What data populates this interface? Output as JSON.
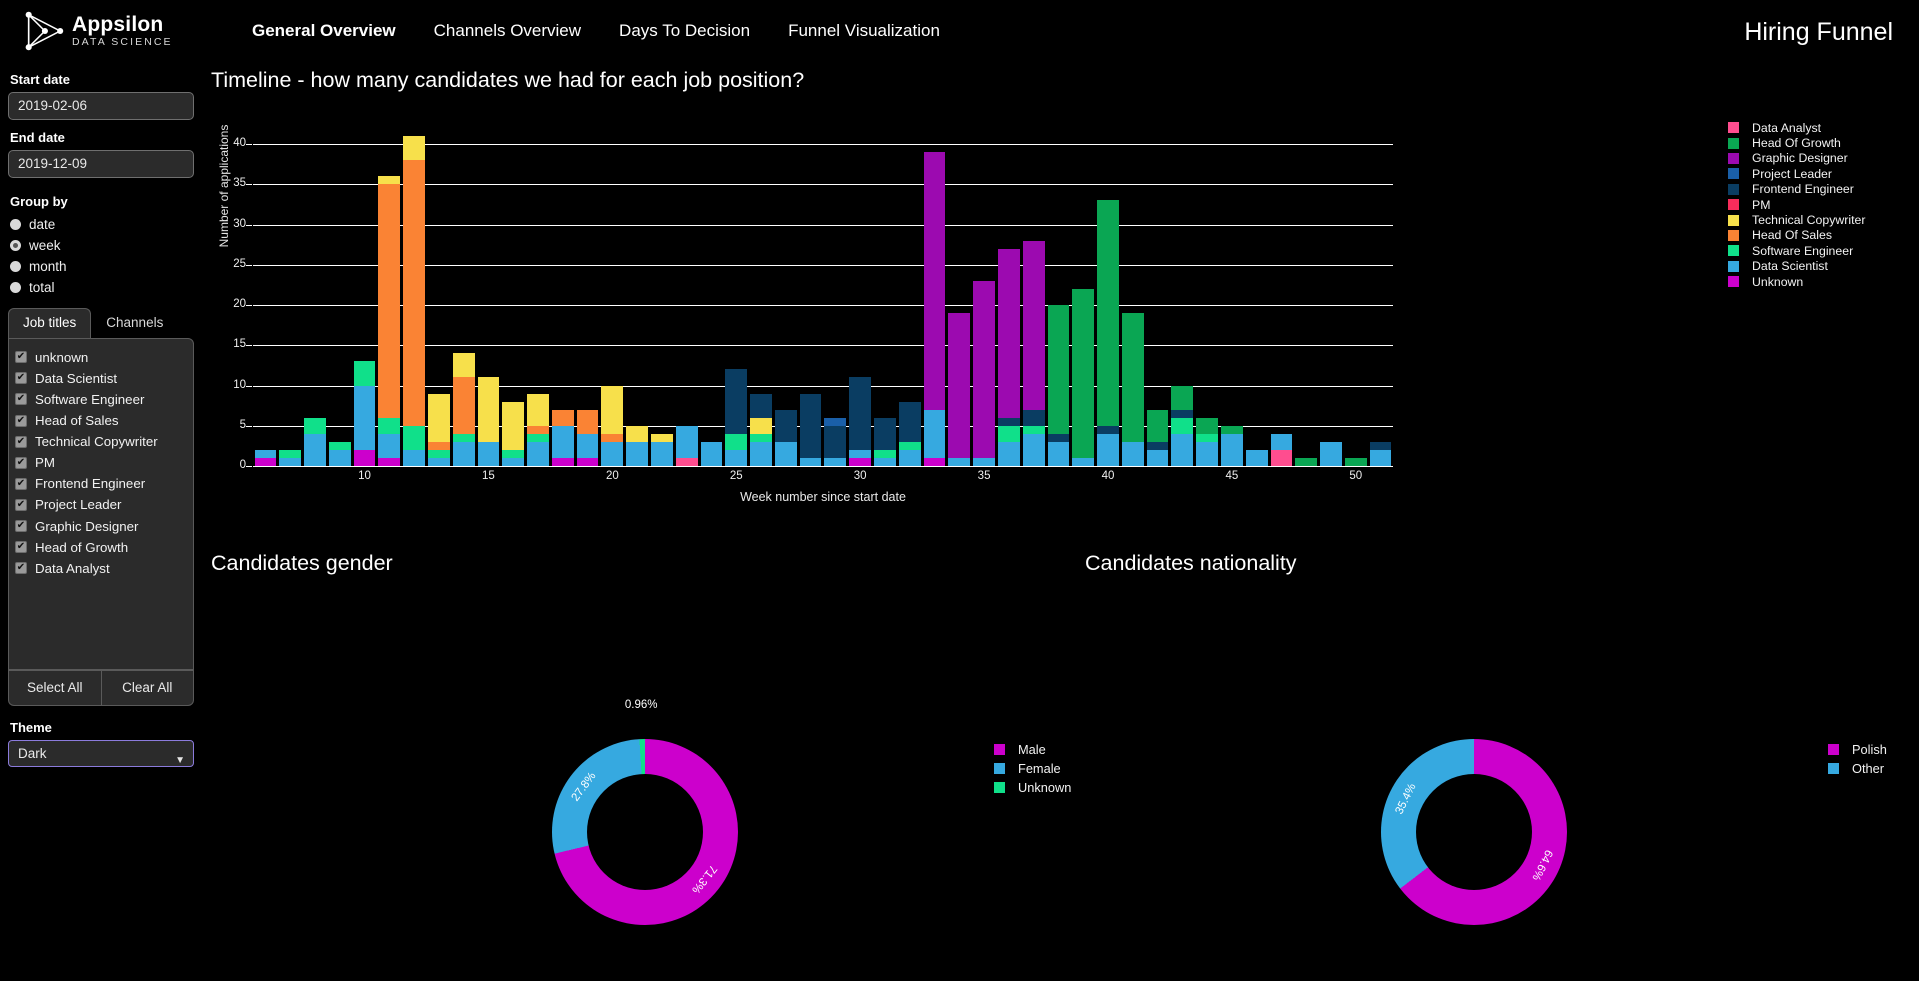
{
  "brand": {
    "name": "Appsilon",
    "tagline": "DATA SCIENCE",
    "logo_icon": "triangle-arrow-logo"
  },
  "nav": {
    "items": [
      {
        "label": "General Overview",
        "active": true
      },
      {
        "label": "Channels Overview",
        "active": false
      },
      {
        "label": "Days To Decision",
        "active": false
      },
      {
        "label": "Funnel Visualization",
        "active": false
      }
    ]
  },
  "app_title": "Hiring Funnel",
  "sidebar": {
    "start_date": {
      "label": "Start date",
      "value": "2019-02-06"
    },
    "end_date": {
      "label": "End date",
      "value": "2019-12-09"
    },
    "group_by": {
      "label": "Group by",
      "options": [
        "date",
        "week",
        "month",
        "total"
      ],
      "selected": "week"
    },
    "tabs": [
      {
        "label": "Job titles",
        "active": true
      },
      {
        "label": "Channels",
        "active": false
      }
    ],
    "job_titles": [
      {
        "label": "unknown",
        "checked": true
      },
      {
        "label": "Data Scientist",
        "checked": true
      },
      {
        "label": "Software Engineer",
        "checked": true
      },
      {
        "label": "Head of Sales",
        "checked": true
      },
      {
        "label": "Technical Copywriter",
        "checked": true
      },
      {
        "label": "PM",
        "checked": true
      },
      {
        "label": "Frontend Engineer",
        "checked": true
      },
      {
        "label": "Project Leader",
        "checked": true
      },
      {
        "label": "Graphic Designer",
        "checked": true
      },
      {
        "label": "Head of Growth",
        "checked": true
      },
      {
        "label": "Data Analyst",
        "checked": true
      }
    ],
    "select_all_label": "Select All",
    "clear_all_label": "Clear All",
    "theme": {
      "label": "Theme",
      "value": "Dark",
      "caret_icon": "chevron-down-icon"
    }
  },
  "chart_data": [
    {
      "id": "timeline",
      "type": "bar",
      "stacked": true,
      "title": "Timeline - how many candidates we had for each job position?",
      "xlabel": "Week number since start date",
      "ylabel": "Number of applications",
      "ylim": [
        0,
        41
      ],
      "yticks": [
        0,
        5,
        10,
        15,
        20,
        25,
        30,
        35,
        40
      ],
      "xticks": [
        10,
        15,
        20,
        25,
        30,
        35,
        40,
        45,
        50
      ],
      "grid": true,
      "legend_position": "right",
      "series": [
        {
          "name": "Data Analyst",
          "color": "#ff4d8f"
        },
        {
          "name": "Head Of Growth",
          "color": "#0aa653"
        },
        {
          "name": "Graphic Designer",
          "color": "#9c0ab0"
        },
        {
          "name": "Project Leader",
          "color": "#1a5fa8"
        },
        {
          "name": "Frontend Engineer",
          "color": "#0a3d62"
        },
        {
          "name": "PM",
          "color": "#f72c5b"
        },
        {
          "name": "Technical Copywriter",
          "color": "#f7e04b"
        },
        {
          "name": "Head Of Sales",
          "color": "#fa8334"
        },
        {
          "name": "Software Engineer",
          "color": "#10e08a"
        },
        {
          "name": "Data Scientist",
          "color": "#36a9e0"
        },
        {
          "name": "Unknown",
          "color": "#cc00cc"
        }
      ],
      "categories": [
        6,
        7,
        8,
        9,
        10,
        11,
        12,
        13,
        14,
        15,
        16,
        17,
        18,
        19,
        20,
        21,
        22,
        23,
        24,
        25,
        26,
        27,
        28,
        29,
        30,
        31,
        32,
        33,
        34,
        35,
        36,
        37,
        38,
        39,
        40,
        41,
        42,
        43,
        44,
        45,
        46,
        47,
        48,
        49,
        50
      ],
      "bars": [
        {
          "week": 6,
          "total": 2,
          "stack": [
            [
              "Unknown",
              1
            ],
            [
              "Data Scientist",
              1
            ]
          ]
        },
        {
          "week": 7,
          "total": 2,
          "stack": [
            [
              "Data Scientist",
              1
            ],
            [
              "Software Engineer",
              1
            ]
          ]
        },
        {
          "week": 8,
          "total": 6,
          "stack": [
            [
              "Data Scientist",
              4
            ],
            [
              "Software Engineer",
              2
            ]
          ]
        },
        {
          "week": 9,
          "total": 3,
          "stack": [
            [
              "Data Scientist",
              2
            ],
            [
              "Software Engineer",
              1
            ]
          ]
        },
        {
          "week": 10,
          "total": 13,
          "stack": [
            [
              "Unknown",
              2
            ],
            [
              "Data Scientist",
              8
            ],
            [
              "Software Engineer",
              3
            ]
          ]
        },
        {
          "week": 11,
          "total": 36,
          "stack": [
            [
              "Unknown",
              1
            ],
            [
              "Data Scientist",
              3
            ],
            [
              "Software Engineer",
              2
            ],
            [
              "Head Of Sales",
              29
            ],
            [
              "Technical Copywriter",
              1
            ]
          ]
        },
        {
          "week": 12,
          "total": 41,
          "stack": [
            [
              "Data Scientist",
              2
            ],
            [
              "Software Engineer",
              3
            ],
            [
              "Head Of Sales",
              33
            ],
            [
              "Technical Copywriter",
              3
            ]
          ]
        },
        {
          "week": 13,
          "total": 9,
          "stack": [
            [
              "Data Scientist",
              1
            ],
            [
              "Software Engineer",
              1
            ],
            [
              "Head Of Sales",
              1
            ],
            [
              "Technical Copywriter",
              6
            ]
          ]
        },
        {
          "week": 14,
          "total": 14,
          "stack": [
            [
              "Data Scientist",
              3
            ],
            [
              "Software Engineer",
              1
            ],
            [
              "Head Of Sales",
              7
            ],
            [
              "Technical Copywriter",
              3
            ]
          ]
        },
        {
          "week": 15,
          "total": 11,
          "stack": [
            [
              "Data Scientist",
              3
            ],
            [
              "Technical Copywriter",
              8
            ]
          ]
        },
        {
          "week": 16,
          "total": 8,
          "stack": [
            [
              "Data Scientist",
              1
            ],
            [
              "Software Engineer",
              1
            ],
            [
              "Technical Copywriter",
              6
            ]
          ]
        },
        {
          "week": 17,
          "total": 9,
          "stack": [
            [
              "Data Scientist",
              3
            ],
            [
              "Software Engineer",
              1
            ],
            [
              "Head Of Sales",
              1
            ],
            [
              "Technical Copywriter",
              4
            ]
          ]
        },
        {
          "week": 18,
          "total": 7,
          "stack": [
            [
              "Unknown",
              1
            ],
            [
              "Data Scientist",
              4
            ],
            [
              "Head Of Sales",
              2
            ]
          ]
        },
        {
          "week": 19,
          "total": 7,
          "stack": [
            [
              "Unknown",
              1
            ],
            [
              "Data Scientist",
              3
            ],
            [
              "Head Of Sales",
              3
            ]
          ]
        },
        {
          "week": 20,
          "total": 10,
          "stack": [
            [
              "Data Scientist",
              3
            ],
            [
              "Head Of Sales",
              1
            ],
            [
              "Technical Copywriter",
              6
            ]
          ]
        },
        {
          "week": 21,
          "total": 5,
          "stack": [
            [
              "Data Scientist",
              3
            ],
            [
              "Technical Copywriter",
              2
            ]
          ]
        },
        {
          "week": 22,
          "total": 4,
          "stack": [
            [
              "Data Scientist",
              3
            ],
            [
              "Technical Copywriter",
              1
            ]
          ]
        },
        {
          "week": 23,
          "total": 5,
          "stack": [
            [
              "Data Analyst",
              1
            ],
            [
              "Data Scientist",
              4
            ]
          ]
        },
        {
          "week": 24,
          "total": 3,
          "stack": [
            [
              "Data Scientist",
              3
            ]
          ]
        },
        {
          "week": 25,
          "total": 12,
          "stack": [
            [
              "Data Scientist",
              2
            ],
            [
              "Software Engineer",
              2
            ],
            [
              "Frontend Engineer",
              8
            ]
          ]
        },
        {
          "week": 26,
          "total": 9,
          "stack": [
            [
              "Data Scientist",
              3
            ],
            [
              "Software Engineer",
              1
            ],
            [
              "Technical Copywriter",
              2
            ],
            [
              "Frontend Engineer",
              3
            ]
          ]
        },
        {
          "week": 27,
          "total": 7,
          "stack": [
            [
              "Data Scientist",
              3
            ],
            [
              "Frontend Engineer",
              4
            ]
          ]
        },
        {
          "week": 28,
          "total": 9,
          "stack": [
            [
              "Data Scientist",
              1
            ],
            [
              "Frontend Engineer",
              8
            ]
          ]
        },
        {
          "week": 29,
          "total": 6,
          "stack": [
            [
              "Data Scientist",
              1
            ],
            [
              "Frontend Engineer",
              4
            ],
            [
              "Project Leader",
              1
            ]
          ]
        },
        {
          "week": 30,
          "total": 11,
          "stack": [
            [
              "Unknown",
              1
            ],
            [
              "Data Scientist",
              1
            ],
            [
              "Frontend Engineer",
              9
            ]
          ]
        },
        {
          "week": 31,
          "total": 6,
          "stack": [
            [
              "Data Scientist",
              1
            ],
            [
              "Software Engineer",
              1
            ],
            [
              "Frontend Engineer",
              4
            ]
          ]
        },
        {
          "week": 32,
          "total": 8,
          "stack": [
            [
              "Data Scientist",
              2
            ],
            [
              "Software Engineer",
              1
            ],
            [
              "Frontend Engineer",
              5
            ]
          ]
        },
        {
          "week": 33,
          "total": 39,
          "stack": [
            [
              "Unknown",
              1
            ],
            [
              "Data Scientist",
              6
            ],
            [
              "Graphic Designer",
              32
            ]
          ]
        },
        {
          "week": 34,
          "total": 19,
          "stack": [
            [
              "Data Scientist",
              1
            ],
            [
              "Graphic Designer",
              18
            ]
          ]
        },
        {
          "week": 35,
          "total": 23,
          "stack": [
            [
              "Data Scientist",
              1
            ],
            [
              "Graphic Designer",
              22
            ]
          ]
        },
        {
          "week": 36,
          "total": 27,
          "stack": [
            [
              "Data Scientist",
              3
            ],
            [
              "Software Engineer",
              2
            ],
            [
              "Frontend Engineer",
              1
            ],
            [
              "Graphic Designer",
              21
            ]
          ]
        },
        {
          "week": 37,
          "total": 28,
          "stack": [
            [
              "Data Scientist",
              4
            ],
            [
              "Software Engineer",
              1
            ],
            [
              "Frontend Engineer",
              2
            ],
            [
              "Graphic Designer",
              21
            ]
          ]
        },
        {
          "week": 38,
          "total": 20,
          "stack": [
            [
              "Data Scientist",
              3
            ],
            [
              "Frontend Engineer",
              1
            ],
            [
              "Head Of Growth",
              16
            ]
          ]
        },
        {
          "week": 39,
          "total": 22,
          "stack": [
            [
              "Data Scientist",
              1
            ],
            [
              "Head Of Growth",
              21
            ]
          ]
        },
        {
          "week": 40,
          "total": 33,
          "stack": [
            [
              "Data Scientist",
              4
            ],
            [
              "Frontend Engineer",
              1
            ],
            [
              "Head Of Growth",
              28
            ]
          ]
        },
        {
          "week": 41,
          "total": 19,
          "stack": [
            [
              "Data Scientist",
              3
            ],
            [
              "Head Of Growth",
              16
            ]
          ]
        },
        {
          "week": 42,
          "total": 7,
          "stack": [
            [
              "Data Scientist",
              2
            ],
            [
              "Frontend Engineer",
              1
            ],
            [
              "Head Of Growth",
              4
            ]
          ]
        },
        {
          "week": 43,
          "total": 10,
          "stack": [
            [
              "Data Scientist",
              4
            ],
            [
              "Software Engineer",
              2
            ],
            [
              "Frontend Engineer",
              1
            ],
            [
              "Head Of Growth",
              3
            ]
          ]
        },
        {
          "week": 44,
          "total": 6,
          "stack": [
            [
              "Data Scientist",
              3
            ],
            [
              "Software Engineer",
              1
            ],
            [
              "Head Of Growth",
              2
            ]
          ]
        },
        {
          "week": 45,
          "total": 5,
          "stack": [
            [
              "Data Scientist",
              4
            ],
            [
              "Head Of Growth",
              1
            ]
          ]
        },
        {
          "week": 46,
          "total": 2,
          "stack": [
            [
              "Data Scientist",
              2
            ]
          ]
        },
        {
          "week": 47,
          "total": 4,
          "stack": [
            [
              "Data Analyst",
              2
            ],
            [
              "Data Scientist",
              2
            ]
          ]
        },
        {
          "week": 48,
          "total": 1,
          "stack": [
            [
              "Head Of Growth",
              1
            ]
          ]
        },
        {
          "week": 49,
          "total": 3,
          "stack": [
            [
              "Data Scientist",
              3
            ]
          ]
        },
        {
          "week": 50,
          "total": 1,
          "stack": [
            [
              "Head Of Growth",
              1
            ]
          ]
        },
        {
          "week": 51,
          "total": 3,
          "stack": [
            [
              "Data Scientist",
              2
            ],
            [
              "Frontend Engineer",
              1
            ]
          ]
        }
      ]
    },
    {
      "id": "gender",
      "type": "pie",
      "donut": true,
      "title": "Candidates gender",
      "legend_position": "left",
      "labels": [
        "Male",
        "Female",
        "Unknown"
      ],
      "values": [
        71.3,
        27.8,
        0.96
      ],
      "value_labels": [
        "71.3%",
        "27.8%",
        "0.96%"
      ],
      "colors": [
        "#cc00cc",
        "#36a9e0",
        "#10e08a"
      ]
    },
    {
      "id": "nationality",
      "type": "pie",
      "donut": true,
      "title": "Candidates nationality",
      "legend_position": "right",
      "labels": [
        "Polish",
        "Other"
      ],
      "values": [
        64.6,
        35.4
      ],
      "value_labels": [
        "64.6%",
        "35.4%"
      ],
      "colors": [
        "#cc00cc",
        "#36a9e0"
      ]
    }
  ]
}
